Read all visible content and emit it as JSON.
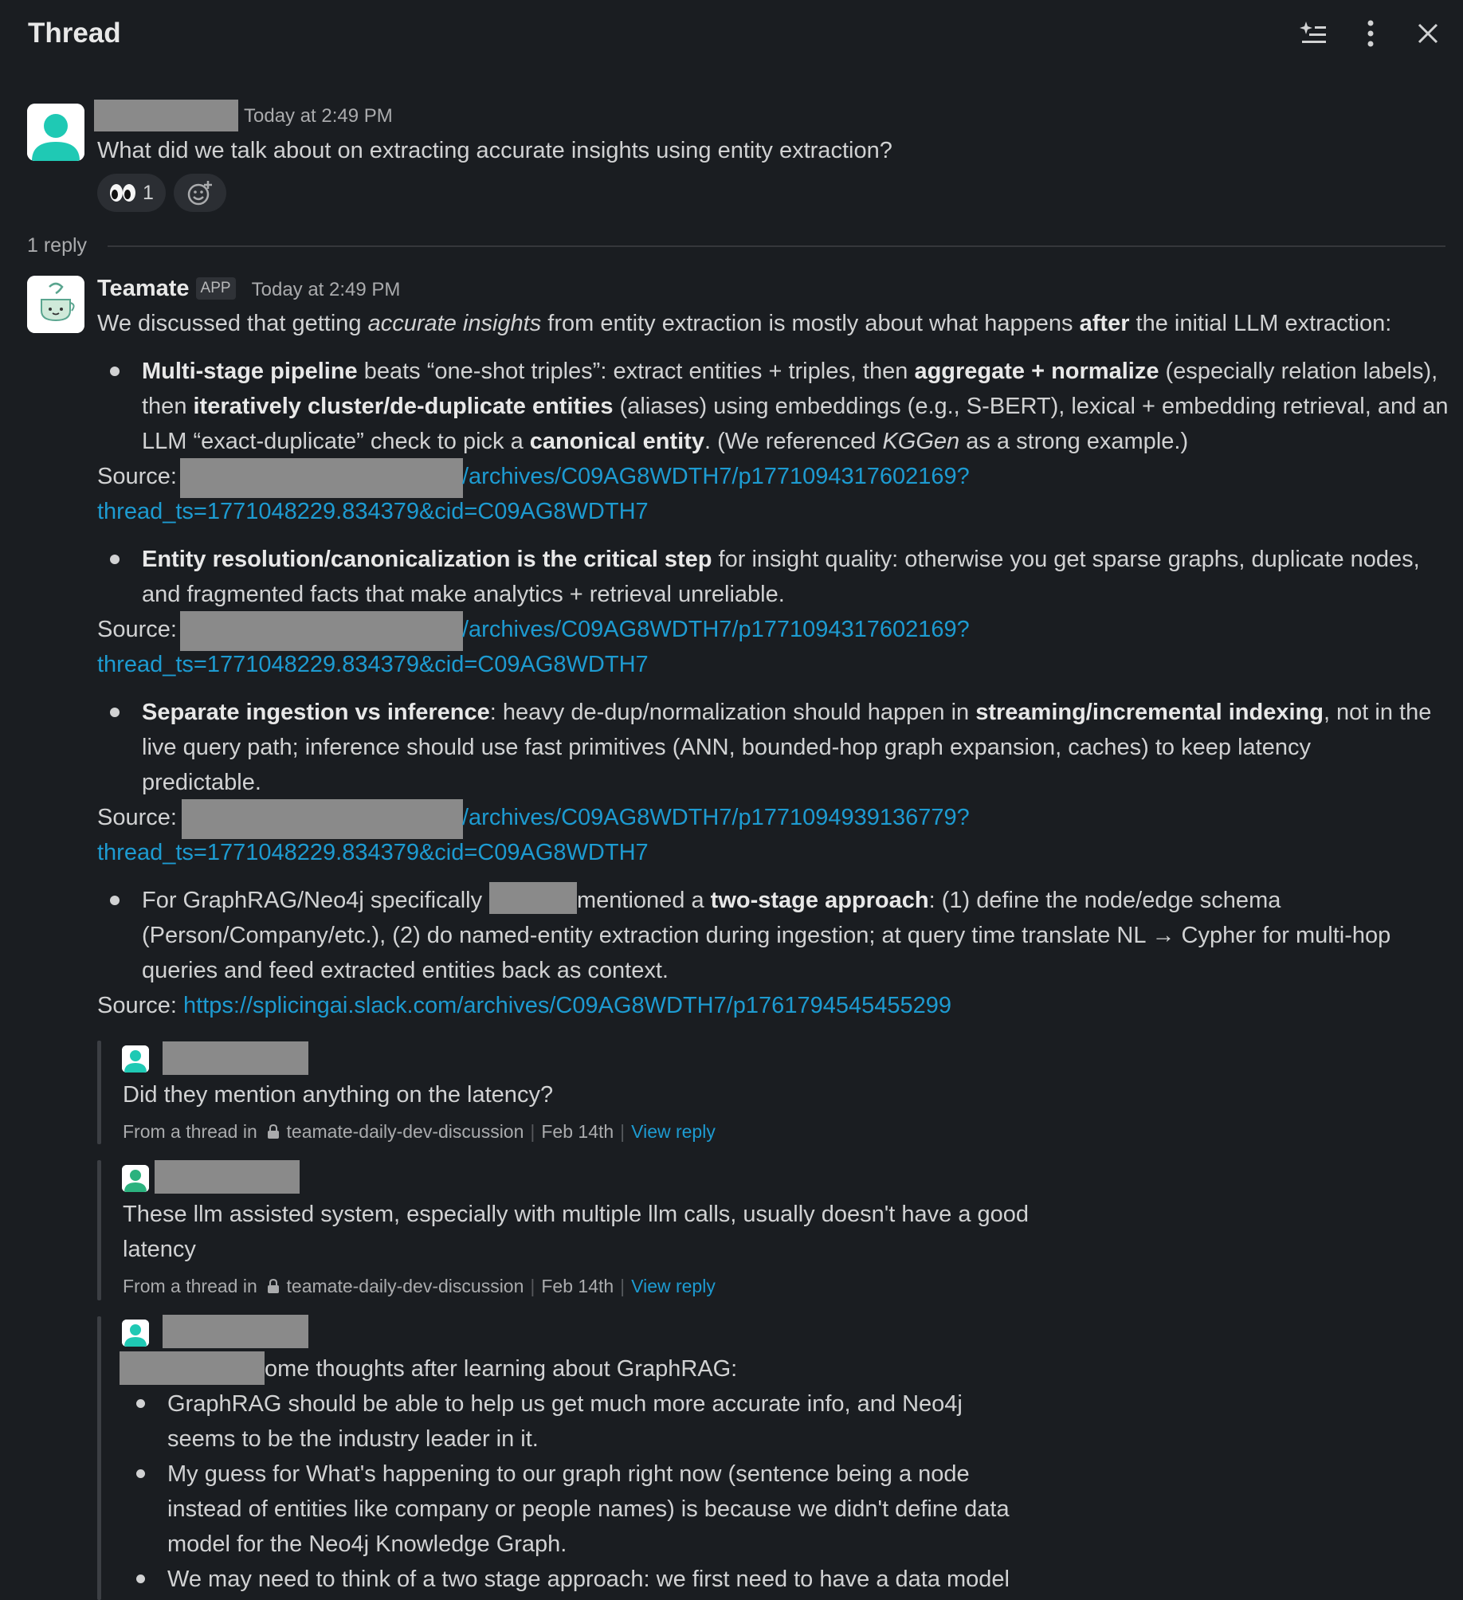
{
  "header": {
    "title": "Thread"
  },
  "parent": {
    "timestamp": "Today at 2:49 PM",
    "text": "What did we talk about on extracting accurate insights using entity extraction?",
    "reaction_count": "1"
  },
  "replies_label": "1 reply",
  "bot": {
    "name": "Teamate",
    "badge": "APP",
    "timestamp": "Today at 2:49 PM",
    "intro": {
      "a": "We discussed that getting ",
      "b": "accurate insights",
      "c": " from entity extraction is mostly about what happens ",
      "d": "after",
      "e": " the initial LLM extraction:"
    },
    "b1": {
      "l1a": "Multi-stage pipeline",
      "l1b": " beats “one-shot triples”: extract entities + triples, then ",
      "l1c": "aggregate + normalize",
      "l1d": " (especially relation labels),",
      "l2a": "then ",
      "l2b": "iteratively cluster/de-duplicate entities",
      "l2c": " (aliases) using embeddings (e.g., S-BERT), lexical + embedding retrieval, and an",
      "l3a": "LLM “exact-duplicate” check to pick a ",
      "l3b": "canonical entity",
      "l3c": ". (We referenced ",
      "l3d": "KGGen",
      "l3e": " as a strong example.)"
    },
    "b2": {
      "l1a": "Entity resolution/canonicalization is the critical step",
      "l1b": " for insight quality: otherwise you get sparse graphs, duplicate nodes,",
      "l2": "and fragmented facts that make analytics + retrieval unreliable."
    },
    "b3": {
      "l1a": "Separate ingestion vs inference",
      "l1b": ": heavy de-dup/normalization should happen in ",
      "l1c": "streaming/incremental indexing",
      "l1d": ", not in the",
      "l2": "live query path; inference should use fast primitives (ANN, bounded-hop graph expansion, caches) to keep latency",
      "l3": "predictable."
    },
    "b4": {
      "l1a": "For GraphRAG/Neo4j specifically",
      "l1b": "mentioned a ",
      "l1c": "two-stage approach",
      "l1d": ": (1) define the node/edge schema",
      "l2": "(Person/Company/etc.), (2) do named-entity extraction during ingestion; at query time translate NL → Cypher for multi-hop",
      "l3": "queries and feed extracted entities back as context."
    },
    "source_label": "Source:",
    "src1": {
      "a": "/archives/C09AG8WDTH7/p1771094317602169?",
      "b": "thread_ts=1771048229.834379&cid=C09AG8WDTH7"
    },
    "src2": {
      "a": "/archives/C09AG8WDTH7/p1771094317602169?",
      "b": "thread_ts=1771048229.834379&cid=C09AG8WDTH7"
    },
    "src3": {
      "a": "/archives/C09AG8WDTH7/p1771094939136779?",
      "b": "thread_ts=1771048229.834379&cid=C09AG8WDTH7"
    },
    "src4": "https://splicingai.slack.com/archives/C09AG8WDTH7/p1761794545455299"
  },
  "quotes": {
    "q1": {
      "text": "Did they mention anything on the latency?",
      "from": "From a thread in",
      "channel": "teamate-daily-dev-discussion",
      "date": "Feb 14th",
      "view": "View reply"
    },
    "q2": {
      "l1": "These llm assisted system, especially with multiple llm calls, usually doesn't have a good",
      "l2": "latency",
      "from": "From a thread in",
      "channel": "teamate-daily-dev-discussion",
      "date": "Feb 14th",
      "view": "View reply"
    },
    "q3": {
      "intro": "ome thoughts after learning about GraphRAG:",
      "i1a": "GraphRAG should be able to help us get much more accurate info, and Neo4j",
      "i1b": "seems to be the industry leader in it.",
      "i2a": "My guess for What's happening to our graph right now (sentence being a node",
      "i2b": "instead of entities like company or people names) is because we didn't define data",
      "i2c": "model for the Neo4j Knowledge Graph.",
      "i3a": "We may need to think of a two stage approach: we first need to have a data model"
    }
  },
  "colors": {
    "background": "#1a1d21",
    "link": "#1d9bd1",
    "avatar": "#1fc9b4",
    "redaction": "#8a8a8a"
  },
  "icons": [
    "ai-summary-icon",
    "more-vertical-icon",
    "close-icon",
    "eyes-emoji",
    "add-reaction-icon",
    "lock-icon"
  ]
}
